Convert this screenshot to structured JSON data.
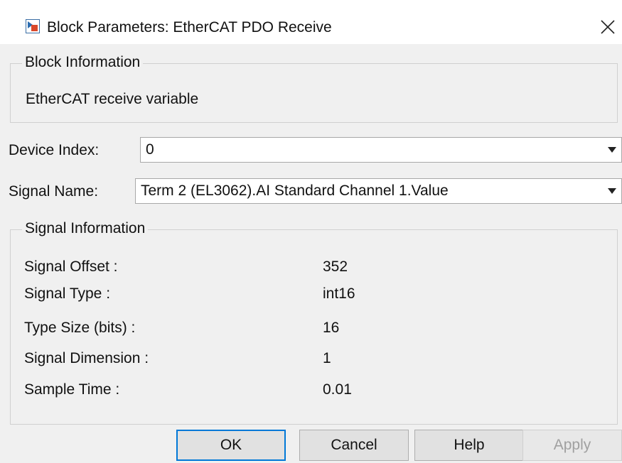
{
  "window": {
    "title": "Block Parameters: EtherCAT PDO Receive",
    "app_icon": "simulink-block-icon",
    "close_icon": "close-icon"
  },
  "block_information": {
    "legend": "Block Information",
    "description": "EtherCAT receive variable"
  },
  "device_index": {
    "label": "Device Index:",
    "value": "0"
  },
  "signal_name": {
    "label": "Signal Name:",
    "value": "Term 2 (EL3062).AI Standard Channel 1.Value"
  },
  "signal_information": {
    "legend": "Signal Information",
    "rows": [
      {
        "label": "Signal Offset :",
        "value": "352"
      },
      {
        "label": "Signal Type :",
        "value": "int16"
      },
      {
        "label": "Type Size (bits) :",
        "value": "16"
      },
      {
        "label": "Signal Dimension :",
        "value": "1"
      },
      {
        "label": "Sample Time :",
        "value": "0.01"
      }
    ]
  },
  "buttons": {
    "ok": "OK",
    "cancel": "Cancel",
    "help": "Help",
    "apply": "Apply"
  },
  "colors": {
    "dialog_bg": "#f0f0f0",
    "focus_accent": "#0078d7",
    "disabled_text": "#a0a0a0"
  }
}
